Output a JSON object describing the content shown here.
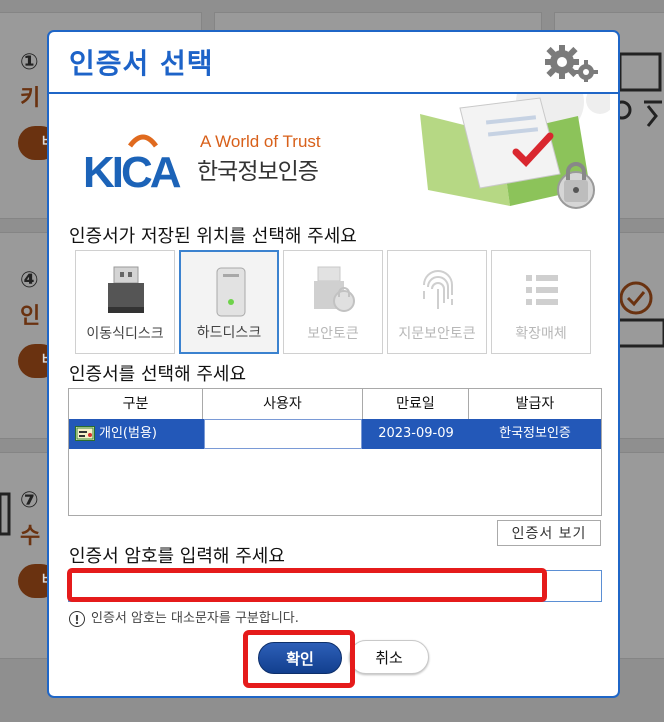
{
  "background": {
    "steps": [
      "①",
      "④",
      "⑦"
    ],
    "sub_labels": [
      "키",
      "인",
      "수"
    ],
    "pill_label": "바"
  },
  "dialog": {
    "title": "인증서 선택",
    "settings_icon": "gear-icon",
    "banner": {
      "logo_word": "KICA",
      "tagline": "A World of Trust",
      "korean_name": "한국정보인증"
    },
    "storage_prompt": "인증서가 저장된 위치를 선택해 주세요",
    "storage_options": [
      {
        "label": "이동식디스크",
        "icon": "usb-drive-icon",
        "state": "normal"
      },
      {
        "label": "하드디스크",
        "icon": "hard-disk-icon",
        "state": "selected"
      },
      {
        "label": "보안토큰",
        "icon": "security-token-icon",
        "state": "disabled"
      },
      {
        "label": "지문보안토큰",
        "icon": "fingerprint-icon",
        "state": "disabled"
      },
      {
        "label": "확장매체",
        "icon": "list-icon",
        "state": "disabled"
      }
    ],
    "cert_prompt": "인증서를 선택해 주세요",
    "table": {
      "headers": [
        "구분",
        "사용자",
        "만료일",
        "발급자"
      ],
      "rows": [
        {
          "type": "개인(범용)",
          "user": "",
          "expiry": "2023-09-09",
          "issuer": "한국정보인증"
        }
      ]
    },
    "view_cert_button": "인증서 보기",
    "password_prompt": "인증서 암호를 입력해 주세요",
    "password_value": "",
    "hint": "인증서 암호는 대소문자를 구분합니다.",
    "ok_button": "확인",
    "cancel_button": "취소"
  },
  "colors": {
    "accent": "#1f66c7",
    "selected_row": "#2358b8",
    "highlight": "#e51b1b"
  }
}
